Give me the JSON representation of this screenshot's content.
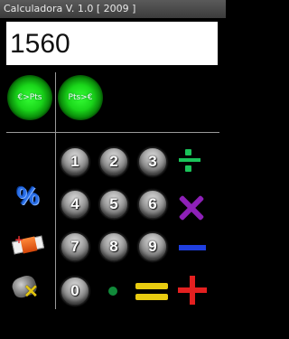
{
  "window": {
    "title": "Calculadora V. 1.0 [ 2009 ]"
  },
  "display": {
    "value": "1560"
  },
  "converters": {
    "euro_to_pts": "€>Pts",
    "pts_to_euro": "Pts>€"
  },
  "keypad": {
    "digits": [
      "1",
      "2",
      "3",
      "4",
      "5",
      "6",
      "7",
      "8",
      "9",
      "0"
    ]
  },
  "operators": {
    "divide": "divide-icon",
    "multiply": "multiply-icon",
    "subtract": "minus-icon",
    "add": "plus-icon",
    "equals": "equals-icon",
    "decimal": "decimal-point-icon"
  },
  "side": {
    "percent": "%",
    "clear": "eraser-icon",
    "backspace": "backspace-icon"
  },
  "colors": {
    "divide": "#1bc35a",
    "multiply": "#8e20b8",
    "subtract": "#1f3fe0",
    "add": "#e42020",
    "equals": "#e9cc10",
    "percent": "#2a6fe8",
    "converter_glow": "#1ad61a"
  }
}
